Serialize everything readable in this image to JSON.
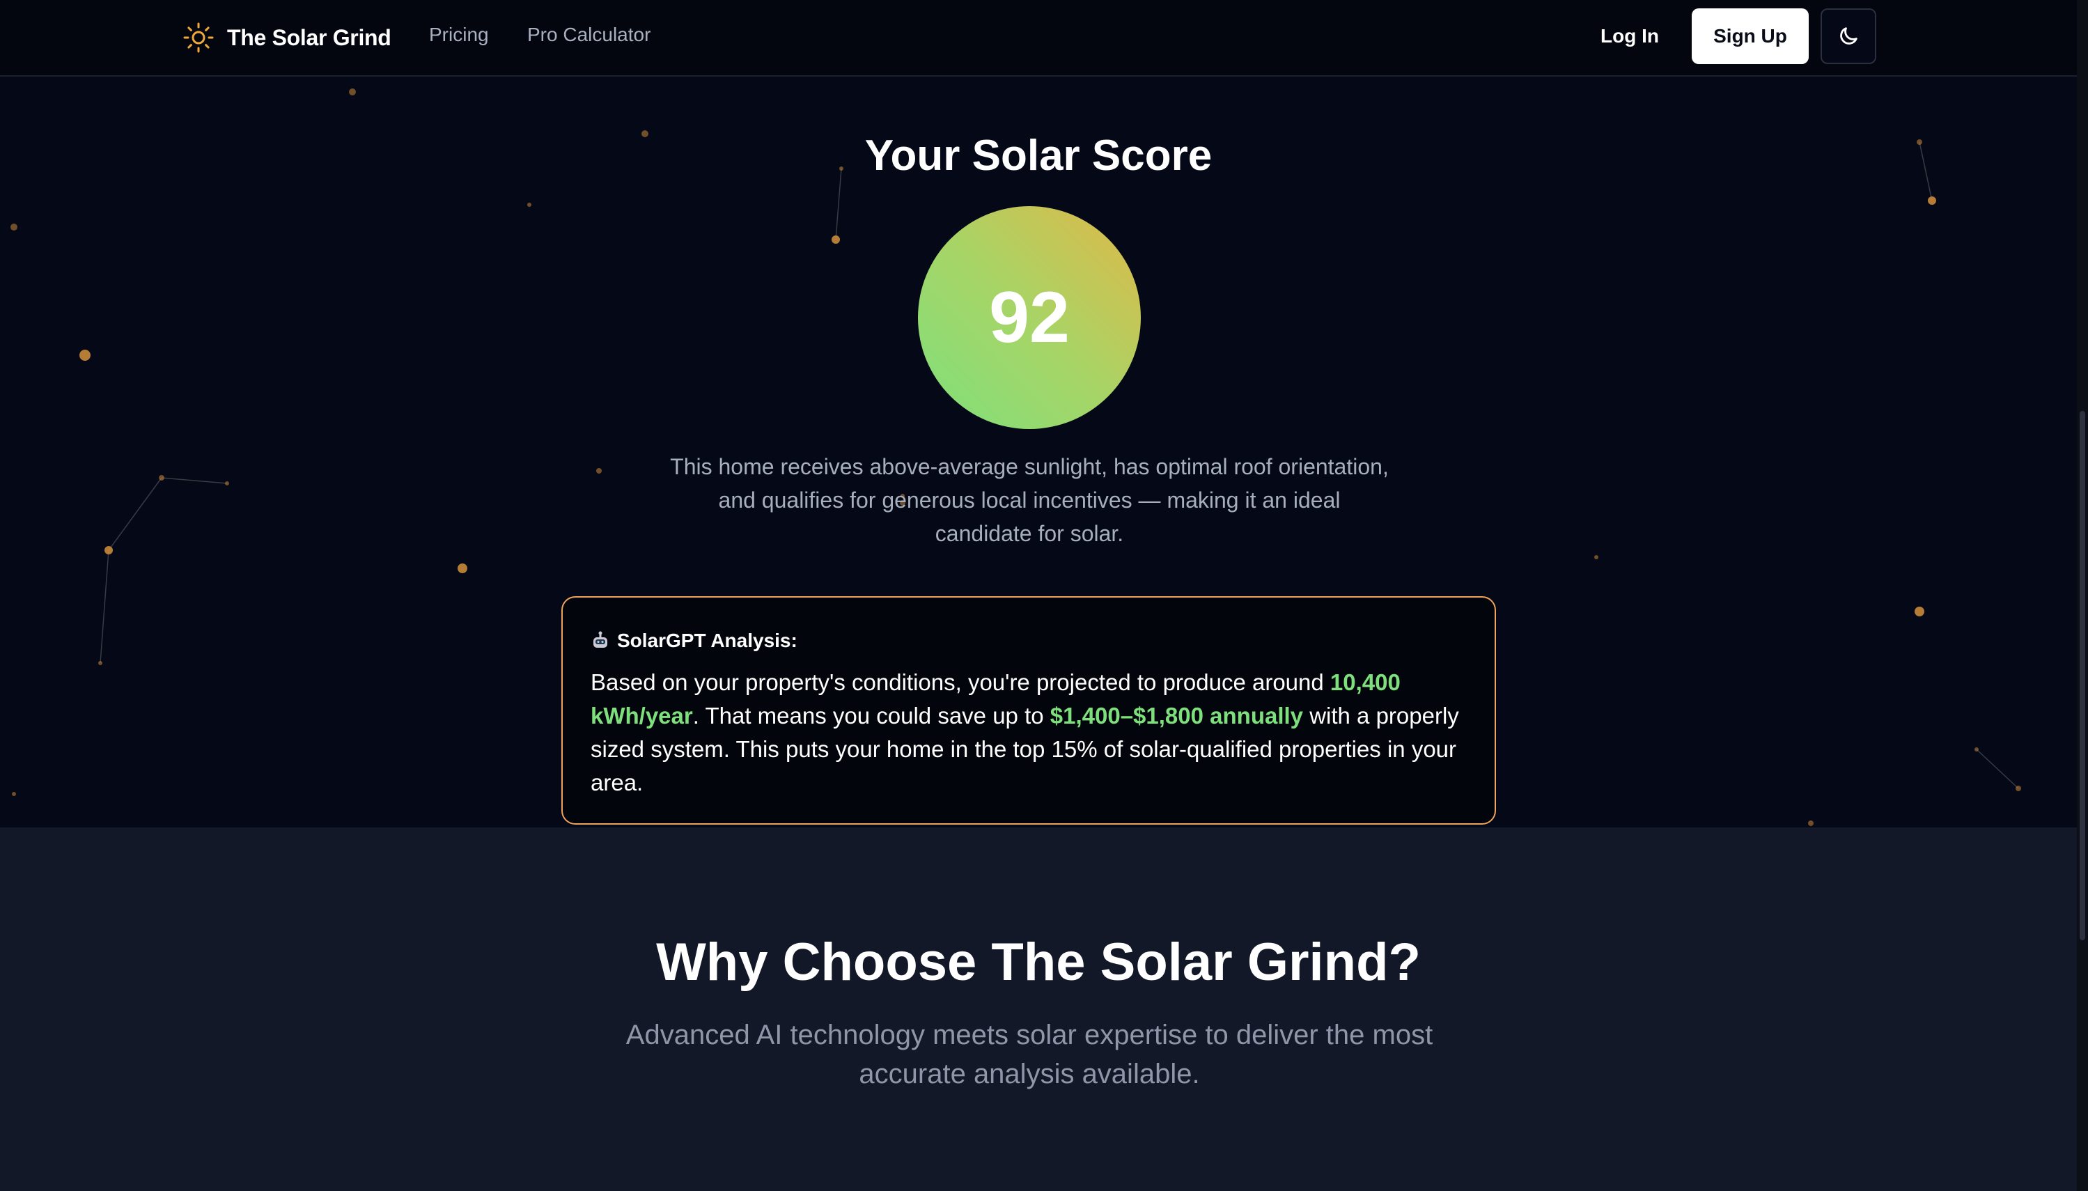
{
  "nav": {
    "brand": "The Solar Grind",
    "links": [
      "Pricing",
      "Pro Calculator"
    ],
    "login": "Log In",
    "signup": "Sign Up",
    "theme_icon": "moon-icon"
  },
  "score": {
    "title": "Your Solar Score",
    "value": "92",
    "description": "This home receives above-average sunlight, has optimal roof orientation, and qualifies for generous local incentives — making it an ideal candidate for solar."
  },
  "analysis": {
    "icon": "robot-icon",
    "heading": "SolarGPT Analysis:",
    "text_1": "Based on your property's conditions, you're projected to produce around ",
    "highlight_1": "10,400 kWh/year",
    "text_2": ". That means you could save up to ",
    "highlight_2": "$1,400–$1,800 annually",
    "text_3": " with a properly sized system. This puts your home in the top 15% of solar-qualified properties in your area."
  },
  "why": {
    "title": "Why Choose The Solar Grind?",
    "subtitle": "Advanced AI technology meets solar expertise to deliver the most accurate analysis available."
  },
  "colors": {
    "background": "#050816",
    "section_background": "#121827",
    "accent_orange": "#f0a35a",
    "highlight_green": "#7ee07c",
    "star": "#f0a35a"
  }
}
